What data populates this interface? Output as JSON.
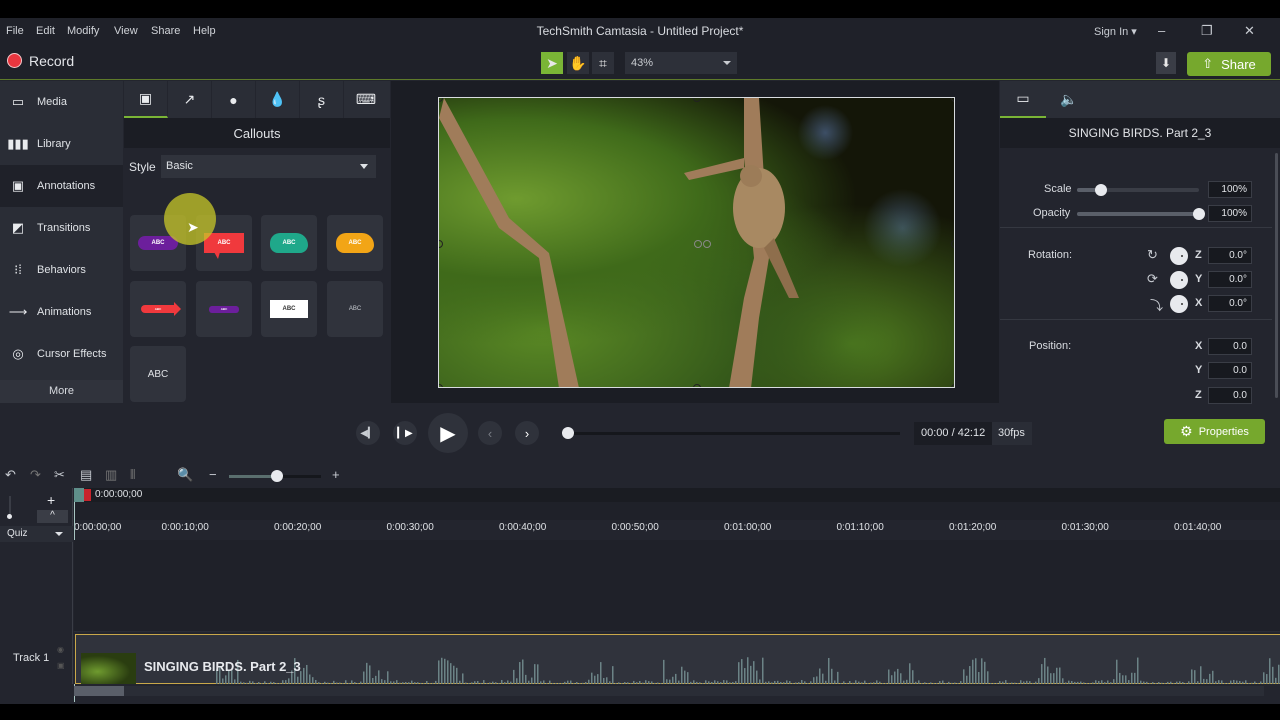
{
  "app": {
    "title": "TechSmith Camtasia - Untitled Project*"
  },
  "menu": [
    "File",
    "Edit",
    "Modify",
    "View",
    "Share",
    "Help"
  ],
  "window_controls": {
    "sign_in": "Sign In ▾",
    "minimize": "–",
    "restore": "❐",
    "close": "✕"
  },
  "toolbar": {
    "record_label": "Record",
    "zoom_level": "43%",
    "share_label": "Share"
  },
  "sidebar": {
    "items": [
      {
        "label": "Media",
        "icon": "film-icon"
      },
      {
        "label": "Library",
        "icon": "library-icon"
      },
      {
        "label": "Annotations",
        "icon": "annotation-icon",
        "active": true
      },
      {
        "label": "Transitions",
        "icon": "transition-icon"
      },
      {
        "label": "Behaviors",
        "icon": "behaviors-icon"
      },
      {
        "label": "Animations",
        "icon": "animation-icon"
      },
      {
        "label": "Cursor Effects",
        "icon": "cursor-effects-icon"
      }
    ],
    "more_label": "More"
  },
  "annotations": {
    "tabs": [
      "callouts",
      "arrows-lines",
      "shapes",
      "blur-highlight",
      "sketch-motion",
      "keystroke"
    ],
    "title": "Callouts",
    "style_label": "Style",
    "style_value": "Basic",
    "callouts": [
      {
        "name": "purple-pill",
        "text": "ABC",
        "color": "#6c1f9c"
      },
      {
        "name": "red-speech",
        "text": "ABC",
        "color": "#f0393d"
      },
      {
        "name": "teal-cloud",
        "text": "ABC",
        "color": "#1fa88a"
      },
      {
        "name": "orange-thought",
        "text": "ABC",
        "color": "#f2a516"
      },
      {
        "name": "red-arrow",
        "text": "ABC",
        "color": "#f0393d"
      },
      {
        "name": "purple-arrow",
        "text": "ABC",
        "color": "#6c1f9c"
      },
      {
        "name": "white-box",
        "text": "ABC",
        "color": "#ffffff"
      },
      {
        "name": "text-small",
        "text": "ABC",
        "color": ""
      },
      {
        "name": "text-large",
        "text": "ABC",
        "color": ""
      }
    ]
  },
  "properties": {
    "title": "SINGING BIRDS. Part 2_3",
    "scale_label": "Scale",
    "scale_value": "100%",
    "scale_fraction": 0.2,
    "opacity_label": "Opacity",
    "opacity_value": "100%",
    "opacity_fraction": 1.0,
    "rotation_label": "Rotation:",
    "rotation": [
      {
        "axis": "Z",
        "value": "0.0°"
      },
      {
        "axis": "Y",
        "value": "0.0°"
      },
      {
        "axis": "X",
        "value": "0.0°"
      }
    ],
    "position_label": "Position:",
    "position": [
      {
        "axis": "X",
        "value": "0.0"
      },
      {
        "axis": "Y",
        "value": "0.0"
      },
      {
        "axis": "Z",
        "value": "0.0"
      }
    ],
    "button_label": "Properties"
  },
  "playback": {
    "time": "00:00 / 42:12",
    "fps": "30fps",
    "progress": 0
  },
  "timeline": {
    "playhead_time": "0:00:00;00",
    "ticks": [
      "0:00:00;00",
      "0:00:10;00",
      "0:00:20;00",
      "0:00:30;00",
      "0:00:40;00",
      "0:00:50;00",
      "0:01:00;00",
      "0:01:10;00",
      "0:01:20;00",
      "0:01:30;00",
      "0:01:40;00"
    ],
    "quiz_label": "Quiz",
    "track_label": "Track 1",
    "clip_title": "SINGING BIRDS. Part 2_3"
  },
  "colors": {
    "accent_green": "#76a82d",
    "record_red": "#e8363f",
    "clip_border": "#c9a84a"
  }
}
